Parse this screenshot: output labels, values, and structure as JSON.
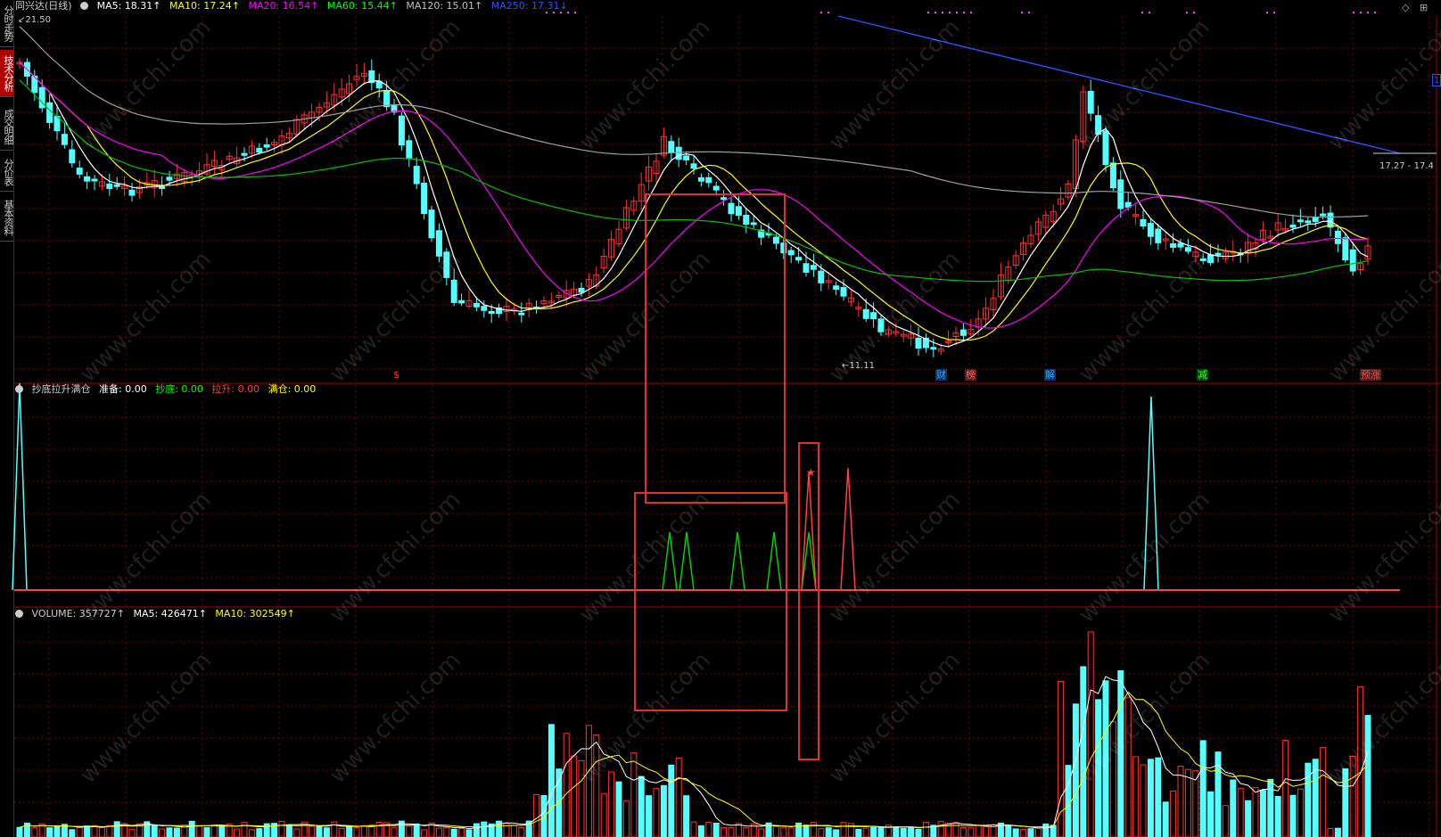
{
  "left_tabs": [
    {
      "label": "分时走势",
      "active": false
    },
    {
      "label": "技术分析",
      "active": true
    },
    {
      "label": "成交明细",
      "active": false
    },
    {
      "label": "分价表",
      "active": false
    },
    {
      "label": "基本资料",
      "active": false
    }
  ],
  "main_header": {
    "title": "同兴达(日线)",
    "items": [
      {
        "label": "MA5: 18.31↑",
        "color": "#ffffff"
      },
      {
        "label": "MA10: 17.24↑",
        "color": "#ffff00"
      },
      {
        "label": "MA20: 16.54↑",
        "color": "#ff00ff"
      },
      {
        "label": "MA60: 15.44↑",
        "color": "#00ff00"
      },
      {
        "label": "MA120: 15.01↑",
        "color": "#c0c0c0"
      },
      {
        "label": "MA250: 17.31↓",
        "color": "#3050ff"
      }
    ]
  },
  "price_labels": {
    "high": "21.50",
    "low": "11.11",
    "range": "17.27 - 17.4",
    "right_mark": "1"
  },
  "event_markers": [
    {
      "label": "$",
      "color": "#ff3030"
    },
    {
      "label": "财",
      "color": "#30a0ff"
    },
    {
      "label": "榜",
      "color": "#ff6060"
    },
    {
      "label": "解",
      "color": "#30a0ff"
    },
    {
      "label": "减",
      "color": "#30ff30"
    },
    {
      "label": "预涨",
      "color": "#ff4040"
    }
  ],
  "indicator_header": {
    "name": "抄底拉升满仓",
    "items": [
      {
        "label": "准备: 0.00",
        "color": "#ffffff"
      },
      {
        "label": "抄底: 0.00",
        "color": "#00ff00"
      },
      {
        "label": "拉升: 0.00",
        "color": "#ff4040"
      },
      {
        "label": "满仓: 0.00",
        "color": "#ffff00"
      }
    ]
  },
  "volume_header": {
    "name": "VOLUME: 357727↑",
    "items": [
      {
        "label": "MA5: 426471↑",
        "color": "#ffffff"
      },
      {
        "label": "MA10: 302549↑",
        "color": "#ffff00"
      }
    ]
  },
  "watermark": "www.cfchi.com",
  "colors": {
    "up": "#ff3030",
    "down": "#54ffff",
    "grid": "#7a0000",
    "highlight_box": "#e03030"
  }
}
